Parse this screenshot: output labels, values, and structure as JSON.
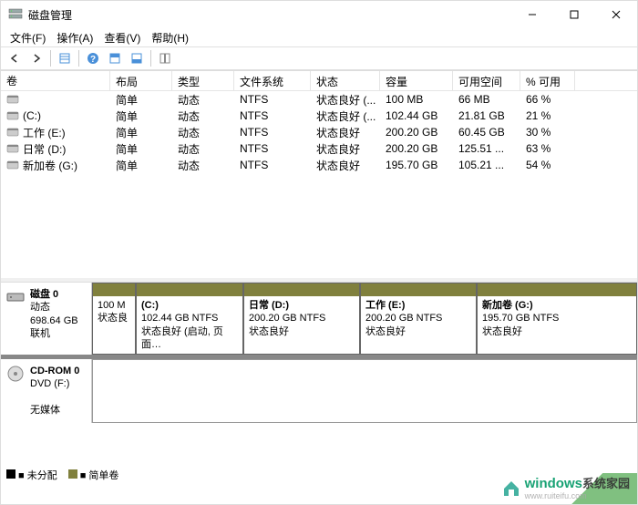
{
  "window": {
    "title": "磁盘管理"
  },
  "menu": {
    "file": "文件(F)",
    "action": "操作(A)",
    "view": "查看(V)",
    "help": "帮助(H)"
  },
  "table": {
    "headers": {
      "name": "卷",
      "layout": "布局",
      "type": "类型",
      "fs": "文件系统",
      "status": "状态",
      "capacity": "容量",
      "free": "可用空间",
      "pct": "% 可用"
    },
    "rows": [
      {
        "name": "",
        "layout": "简单",
        "type": "动态",
        "fs": "NTFS",
        "status": "状态良好 (...",
        "capacity": "100 MB",
        "free": "66 MB",
        "pct": "66 %"
      },
      {
        "name": "(C:)",
        "layout": "简单",
        "type": "动态",
        "fs": "NTFS",
        "status": "状态良好 (...",
        "capacity": "102.44 GB",
        "free": "21.81 GB",
        "pct": "21 %"
      },
      {
        "name": "工作 (E:)",
        "layout": "简单",
        "type": "动态",
        "fs": "NTFS",
        "status": "状态良好",
        "capacity": "200.20 GB",
        "free": "60.45 GB",
        "pct": "30 %"
      },
      {
        "name": "日常 (D:)",
        "layout": "简单",
        "type": "动态",
        "fs": "NTFS",
        "status": "状态良好",
        "capacity": "200.20 GB",
        "free": "125.51 ...",
        "pct": "63 %"
      },
      {
        "name": "新加卷 (G:)",
        "layout": "简单",
        "type": "动态",
        "fs": "NTFS",
        "status": "状态良好",
        "capacity": "195.70 GB",
        "free": "105.21 ...",
        "pct": "54 %"
      }
    ]
  },
  "disk0": {
    "label": "磁盘 0",
    "type": "动态",
    "size": "698.64 GB",
    "state": "联机",
    "parts": [
      {
        "title": "",
        "line1": "100 M",
        "line2": "状态良",
        "kind": "simple",
        "flex": "0 0 48px"
      },
      {
        "title": "(C:)",
        "line1": "102.44 GB NTFS",
        "line2": "状态良好 (启动, 页面…",
        "kind": "simple",
        "flex": "0 0 118px"
      },
      {
        "title": "日常  (D:)",
        "line1": "200.20 GB NTFS",
        "line2": "状态良好",
        "kind": "simple",
        "flex": "0 0 128px"
      },
      {
        "title": "工作  (E:)",
        "line1": "200.20 GB NTFS",
        "line2": "状态良好",
        "kind": "simple",
        "flex": "0 0 128px"
      },
      {
        "title": "新加卷  (G:)",
        "line1": "195.70 GB NTFS",
        "line2": "状态良好",
        "kind": "simple",
        "flex": "1"
      }
    ]
  },
  "cdrom": {
    "label": "CD-ROM 0",
    "desc": "DVD (F:)",
    "state": "无媒体"
  },
  "legend": {
    "unalloc": "未分配",
    "simple": "简单卷"
  },
  "watermark": {
    "brand": "windows",
    "sub": "系统家园",
    "url": "www.ruiteifu.com"
  }
}
